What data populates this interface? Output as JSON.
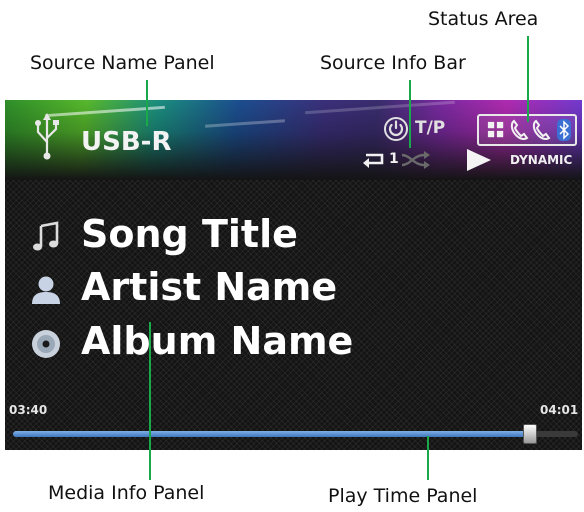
{
  "callouts": {
    "status_area": "Status Area",
    "source_name_panel": "Source Name Panel",
    "source_info_bar": "Source Info Bar",
    "media_info_panel": "Media Info Panel",
    "play_time_panel": "Play Time Panel"
  },
  "screen": {
    "source_name": "USB-R",
    "tp_label": "T/P",
    "repeat_count": "1",
    "sound_mode": "DYNAMIC",
    "song_title": "Song Title",
    "artist_name": "Artist Name",
    "album_name": "Album Name",
    "time_elapsed": "03:40",
    "time_total": "04:01",
    "progress_fraction": 0.913
  },
  "icons": {
    "source": "usb-icon",
    "power": "power-icon",
    "repeat": "repeat-icon",
    "shuffle": "shuffle-icon",
    "play": "play-icon",
    "song": "music-note-icon",
    "artist": "person-icon",
    "album": "disc-icon",
    "status": [
      "grid-icon",
      "phone-icon",
      "phone-icon",
      "bluetooth-icon"
    ]
  },
  "colors": {
    "leader_line": "#19a84a",
    "progress": "#3f77bd",
    "screen_bg": "#141414"
  }
}
